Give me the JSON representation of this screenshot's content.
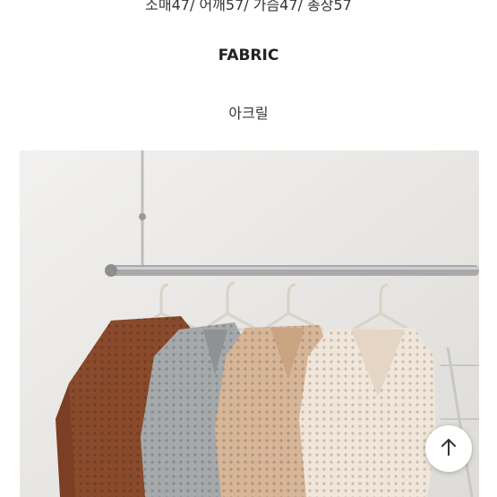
{
  "product": {
    "size_info": "소매47/ 어깨57/ 가슴47/ 총장57",
    "fabric_heading": "FABRIC",
    "fabric_value": "아크릴"
  },
  "photo": {
    "sweater_colors": [
      "#8a4a2c",
      "#a6a9ab",
      "#d7b597",
      "#f1e6da"
    ]
  },
  "scroll_top": {
    "icon": "arrow-up-icon"
  }
}
